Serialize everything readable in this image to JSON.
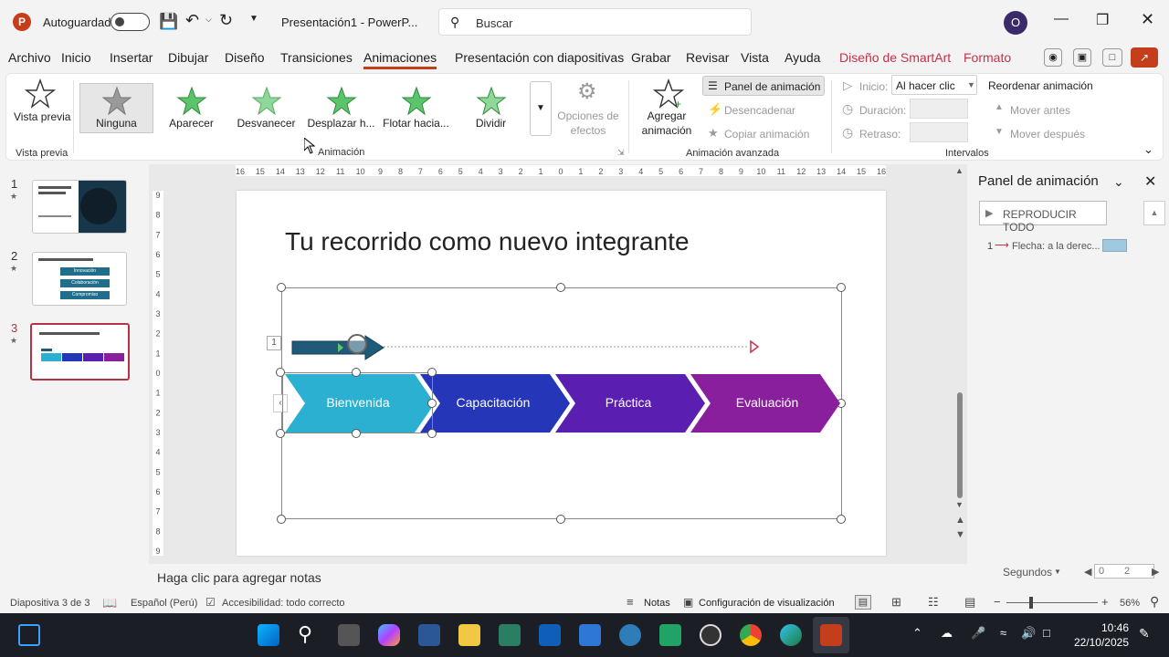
{
  "titlebar": {
    "autosave_label": "Autoguardado",
    "doc_title": "Presentación1 - PowerP...",
    "search_placeholder": "Buscar",
    "avatar_initial": "O"
  },
  "menu": {
    "items": [
      "Archivo",
      "Inicio",
      "Insertar",
      "Dibujar",
      "Diseño",
      "Transiciones",
      "Animaciones",
      "Presentación con diapositivas",
      "Grabar",
      "Revisar",
      "Vista",
      "Ayuda",
      "Diseño de SmartArt",
      "Formato"
    ],
    "active": "Animaciones"
  },
  "ribbon": {
    "preview_label": "Vista previa",
    "preview_button": "Vista previa",
    "effects": [
      "Ninguna",
      "Aparecer",
      "Desvanecer",
      "Desplazar h...",
      "Flotar hacia...",
      "Dividir"
    ],
    "effect_options": "Opciones de efectos",
    "animation_group": "Animación",
    "add_animation": "Agregar animación",
    "animation_panel": "Panel de animación",
    "trigger": "Desencadenar",
    "copy_animation": "Copiar animación",
    "advanced_group": "Animación avanzada",
    "start_label": "Inicio:",
    "start_value": "Al hacer clic",
    "duration_label": "Duración:",
    "delay_label": "Retraso:",
    "reorder_label": "Reordenar animación",
    "move_earlier": "Mover antes",
    "move_later": "Mover después",
    "timing_group": "Intervalos"
  },
  "slides": [
    {
      "num": "1",
      "title": "Bienvenido a Digital Lab"
    },
    {
      "num": "2",
      "labels": [
        "Innovación",
        "Colaboración",
        "Compromiso"
      ]
    },
    {
      "num": "3",
      "title": "Tu recorrido como nuevo integrante"
    }
  ],
  "ruler": {
    "top_ticks": [
      "16",
      "15",
      "14",
      "13",
      "12",
      "11",
      "10",
      "9",
      "8",
      "7",
      "6",
      "5",
      "4",
      "3",
      "2",
      "1",
      "0",
      "1",
      "2",
      "3",
      "4",
      "5",
      "6",
      "7",
      "8",
      "9",
      "10",
      "11",
      "12",
      "13",
      "14",
      "15",
      "16"
    ],
    "side_ticks": [
      "9",
      "8",
      "7",
      "6",
      "5",
      "4",
      "3",
      "2",
      "1",
      "0",
      "1",
      "2",
      "3",
      "4",
      "5",
      "6",
      "7",
      "8",
      "9"
    ]
  },
  "slide": {
    "title": "Tu recorrido como nuevo integrante",
    "anim_marker": "1",
    "chevrons": [
      {
        "label": "Bienvenida",
        "color": "#2bb0d2"
      },
      {
        "label": "Capacitación",
        "color": "#2636b8"
      },
      {
        "label": "Práctica",
        "color": "#5a1fb0"
      },
      {
        "label": "Evaluación",
        "color": "#8a1f9e"
      }
    ],
    "arrow_color": "#1f5a78"
  },
  "anim_pane": {
    "title": "Panel de animación",
    "play_all": "REPRODUCIR TODO",
    "item_num": "1",
    "item_label": "Flecha: a la derec...",
    "seconds_label": "Segundos",
    "timeline_values": [
      "0",
      "2"
    ]
  },
  "notes_placeholder": "Haga clic para agregar notas",
  "status": {
    "slide_info": "Diapositiva 3 de 3",
    "language": "Español (Perú)",
    "accessibility": "Accesibilidad: todo correcto",
    "notes": "Notas",
    "display_settings": "Configuración de visualización",
    "zoom": "56%"
  },
  "taskbar": {
    "time": "10:46",
    "date": "22/10/2025"
  },
  "colors": {
    "accent": "#c43e1c",
    "smartart_tab": "#c4314b",
    "selected_slide_border": "#b83246"
  }
}
